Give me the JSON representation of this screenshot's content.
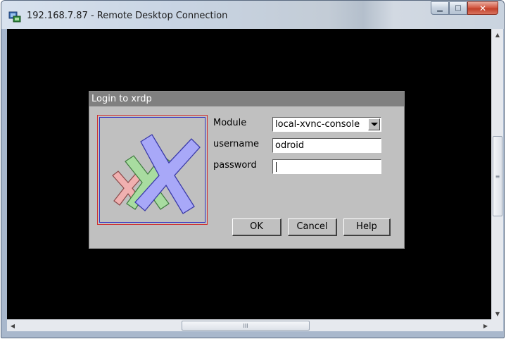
{
  "window": {
    "title": "192.168.7.87 - Remote Desktop Connection",
    "minimize_glyph": "▁",
    "maximize_glyph": "□",
    "close_glyph": "✕"
  },
  "dialog": {
    "title": "Login to xrdp",
    "module_label": "Module",
    "module_value": "local-xvnc-console",
    "username_label": "username",
    "username_value": "odroid",
    "password_label": "password",
    "password_value": "",
    "ok_label": "OK",
    "cancel_label": "Cancel",
    "help_label": "Help"
  },
  "scrollbars": {
    "up_glyph": "▲",
    "down_glyph": "▼",
    "left_glyph": "◀",
    "right_glyph": "▶",
    "grip_glyph": "≡",
    "hgrip_glyph": "III"
  },
  "colors": {
    "logo_pink": "#f0b0b0",
    "logo_green": "#a8dca0",
    "logo_blue": "#a8a8f8"
  }
}
